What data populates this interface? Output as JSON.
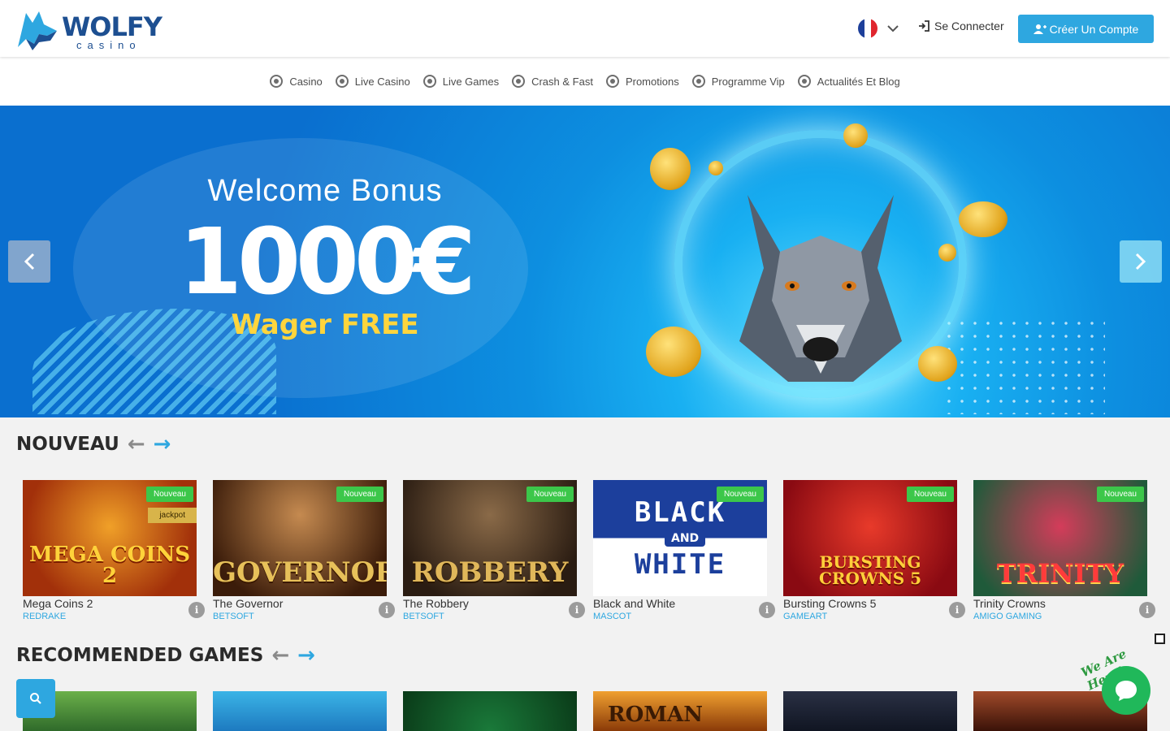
{
  "brand": {
    "name": "WOLFY",
    "tagline": "casino"
  },
  "header": {
    "language_flag": "fr-flag",
    "login_label": "Se Connecter",
    "register_label": "Créer Un Compte"
  },
  "nav": {
    "items": [
      {
        "label": "Casino",
        "icon": "casino-chip-icon"
      },
      {
        "label": "Live Casino",
        "icon": "live-casino-icon"
      },
      {
        "label": "Live Games",
        "icon": "live-games-icon"
      },
      {
        "label": "Crash & Fast",
        "icon": "rocket-icon"
      },
      {
        "label": "Promotions",
        "icon": "gift-icon"
      },
      {
        "label": "Programme Vip",
        "icon": "crown-icon"
      },
      {
        "label": "Actualités Et Blog",
        "icon": "megaphone-icon"
      }
    ]
  },
  "hero": {
    "title": "Welcome Bonus",
    "amount": "1000€",
    "subtitle": "Wager FREE"
  },
  "sections": {
    "new": {
      "title": "NOUVEAU",
      "games": [
        {
          "name": "Mega Coins 2",
          "provider": "REDRAKE",
          "badge": "Nouveau",
          "extra": "jackpot",
          "art": "MEGA COINS 2"
        },
        {
          "name": "The Governor",
          "provider": "BETSOFT",
          "badge": "Nouveau",
          "art": "GOVERNOR"
        },
        {
          "name": "The Robbery",
          "provider": "BETSOFT",
          "badge": "Nouveau",
          "art": "ROBBERY"
        },
        {
          "name": "Black and White",
          "provider": "MASCOT",
          "badge": "Nouveau",
          "art_top": "BLACK",
          "art_mid": "AND",
          "art_bottom": "WHITE"
        },
        {
          "name": "Bursting Crowns 5",
          "provider": "GAMEART",
          "badge": "Nouveau",
          "art": "BURSTING CROWNS 5"
        },
        {
          "name": "Trinity Crowns",
          "provider": "AMIGO GAMING",
          "badge": "Nouveau",
          "art": "TRINITY"
        }
      ]
    },
    "recommended": {
      "title": "RECOMMENDED GAMES",
      "roman_art": "ROMAN"
    }
  },
  "chat": {
    "tag": "We Are Here!"
  },
  "colors": {
    "accent": "#2ea7e0",
    "badge": "#3cc74a",
    "provider": "#2ea7e0",
    "chat": "#20b85a"
  }
}
